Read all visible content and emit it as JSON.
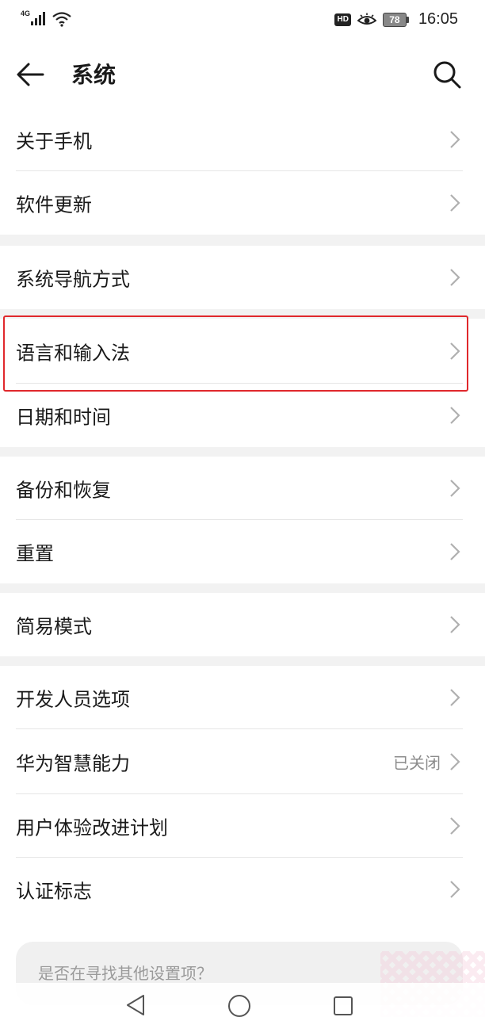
{
  "status_bar": {
    "network": "4G",
    "hd_badge": "HD",
    "battery": "78",
    "time": "16:05",
    "icons": [
      "signal-icon",
      "wifi-icon",
      "eye-comfort-icon",
      "battery-icon"
    ]
  },
  "header": {
    "title": "系统",
    "back_icon": "arrow-left-icon",
    "search_icon": "search-icon"
  },
  "groups": [
    {
      "items": [
        {
          "label": "关于手机"
        },
        {
          "label": "软件更新"
        }
      ]
    },
    {
      "items": [
        {
          "label": "系统导航方式"
        },
        {
          "label": "语言和输入法"
        },
        {
          "label": "日期和时间"
        }
      ]
    },
    {
      "items": [
        {
          "label": "备份和恢复"
        },
        {
          "label": "重置"
        }
      ]
    },
    {
      "items": [
        {
          "label": "简易模式"
        }
      ]
    },
    {
      "items": [
        {
          "label": "开发人员选项"
        },
        {
          "label": "华为智慧能力",
          "value": "已关闭"
        },
        {
          "label": "用户体验改进计划"
        },
        {
          "label": "认证标志"
        }
      ]
    }
  ],
  "suggestion": {
    "text": "是否在寻找其他设置项？"
  },
  "colors": {
    "highlight": "#e0282c",
    "background": "#ffffff",
    "group_gap": "#f2f2f2"
  },
  "nav_bar": {
    "icons": [
      "nav-back-icon",
      "nav-home-icon",
      "nav-recent-icon"
    ]
  }
}
